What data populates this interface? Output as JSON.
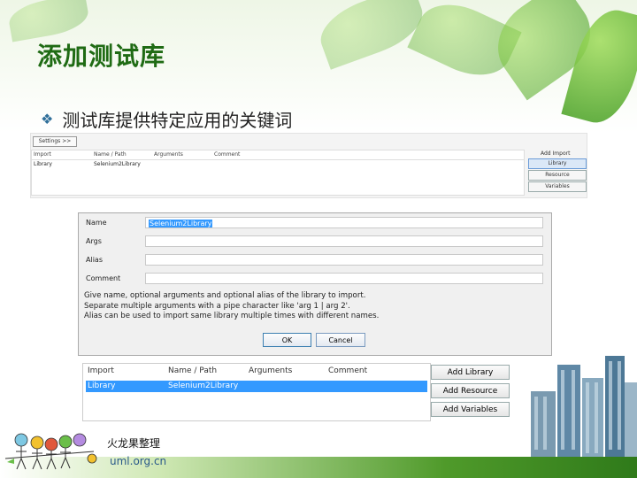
{
  "title": "添加测试库",
  "bullet": "测试库提供特定应用的关键词",
  "top_screenshot": {
    "settings_button": "Settings >>",
    "columns": [
      "Import",
      "Name / Path",
      "Arguments",
      "Comment"
    ],
    "row": [
      "Library",
      "Selenium2Library",
      "",
      ""
    ],
    "add_import_label": "Add Import",
    "buttons": [
      "Library",
      "Resource",
      "Variables"
    ]
  },
  "dialog": {
    "fields": [
      {
        "label": "Name",
        "value": "Selenium2Library"
      },
      {
        "label": "Args",
        "value": ""
      },
      {
        "label": "Alias",
        "value": ""
      },
      {
        "label": "Comment",
        "value": ""
      }
    ],
    "help_lines": [
      "Give name, optional arguments and optional alias of the library to import.",
      "Separate multiple arguments with a pipe character like 'arg 1 | arg 2'.",
      "Alias can be used to import same library multiple times with different names."
    ],
    "ok_label": "OK",
    "cancel_label": "Cancel"
  },
  "import_table": {
    "columns": [
      "Import",
      "Name / Path",
      "Arguments",
      "Comment"
    ],
    "row": [
      "Library",
      "Selenium2Library",
      "",
      ""
    ],
    "buttons": [
      "Add Library",
      "Add Resource",
      "Add Variables"
    ]
  },
  "footer": {
    "brand": "火龙果整理",
    "url": "uml.org.cn"
  },
  "colors": {
    "title_green": "#1f6b14",
    "selection_blue": "#3399ff"
  }
}
